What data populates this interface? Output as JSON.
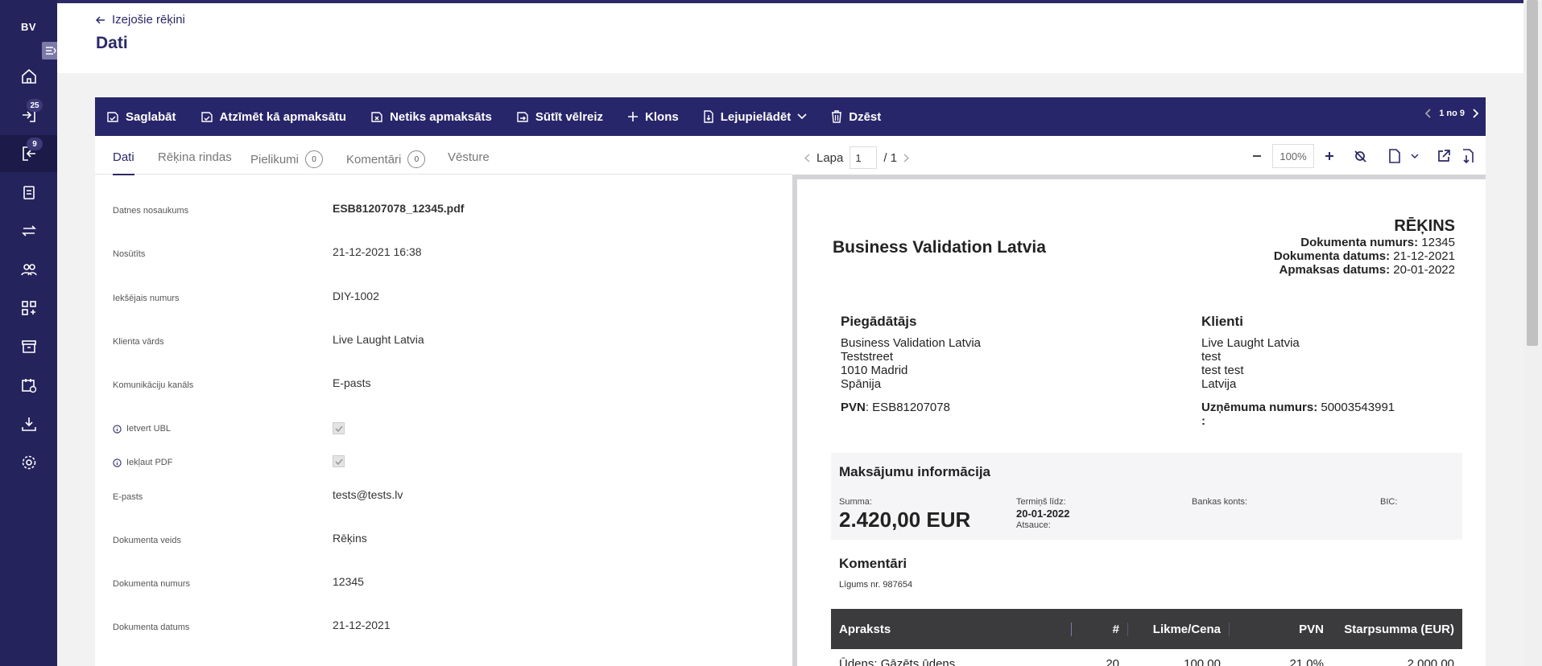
{
  "app": {
    "brand": "BV",
    "nav_badges": {
      "outgoing_in": "25",
      "outgoing_active": "9"
    },
    "icons": [
      "home-icon",
      "inbox-icon",
      "outbox-icon",
      "clipboard-icon",
      "transfer-icon",
      "users-icon",
      "apps-icon",
      "archive-icon",
      "calendar-icon",
      "download-icon",
      "settings-icon"
    ]
  },
  "header": {
    "back_label": "Izejošie rēķini",
    "title": "Dati"
  },
  "toolbar": {
    "save": "Saglabāt",
    "mark_paid": "Atzīmēt kā apmaksātu",
    "not_paid": "Netiks apmaksāts",
    "resend": "Sūtīt vēlreiz",
    "clone": "Klons",
    "download": "Lejupielādēt",
    "delete": "Dzēst",
    "pager": "1 no 9"
  },
  "tabs": [
    {
      "label": "Dati"
    },
    {
      "label": "Rēķina rindas"
    },
    {
      "label": "Pielikumi",
      "count": "0"
    },
    {
      "label": "Komentāri",
      "count": "0"
    },
    {
      "label": "Vēsture"
    }
  ],
  "fields": {
    "file_name": {
      "label": "Datnes nosaukums",
      "value": "ESB81207078_12345.pdf"
    },
    "sent": {
      "label": "Nosūtīts",
      "value": "21-12-2021 16:38"
    },
    "internal_no": {
      "label": "Iekšējais numurs",
      "value": "DIY-1002"
    },
    "client_name": {
      "label": "Klienta vārds",
      "value": "Live Laught Latvia"
    },
    "channel": {
      "label": "Komunikāciju kanāls",
      "value": "E-pasts"
    },
    "include_ubl": {
      "label": "Ietvert UBL",
      "checked": true
    },
    "include_pdf": {
      "label": "Iekļaut PDF",
      "checked": true
    },
    "email": {
      "label": "E-pasts",
      "value": "tests@tests.lv"
    },
    "doc_type": {
      "label": "Dokumenta veids",
      "value": "Rēķins"
    },
    "doc_no": {
      "label": "Dokumenta numurs",
      "value": "12345"
    },
    "doc_date": {
      "label": "Dokumenta datums",
      "value": "21-12-2021"
    }
  },
  "viewer": {
    "page_label": "Lapa",
    "page": "1",
    "page_total": "/ 1",
    "zoom": "100%"
  },
  "invoice": {
    "company": "Business Validation Latvia",
    "heading": "RĒĶINS",
    "doc_no_label": "Dokumenta numurs:",
    "doc_no": "12345",
    "doc_date_label": "Dokumenta datums:",
    "doc_date": "21-12-2021",
    "due_label": "Apmaksas datums:",
    "due": "20-01-2022",
    "supplier": {
      "heading": "Piegādātājs",
      "lines": [
        "Business Validation Latvia",
        "Teststreet",
        "1010 Madrid",
        "Spānija"
      ],
      "vat_label": "PVN",
      "vat": ": ESB81207078"
    },
    "client": {
      "heading": "Klienti",
      "lines": [
        "Live Laught Latvia",
        "test",
        "test test",
        "Latvija"
      ],
      "reg_label": "Uzņēmuma numurs:",
      "reg": "50003543991",
      "reg_tail": ":"
    },
    "payment": {
      "heading": "Maksājumu informācija",
      "sum_label": "Summa:",
      "sum": "2.420,00 EUR",
      "term_label": "Termiņš līdz:",
      "term": "20-01-2022",
      "ref_label": "Atsauce:",
      "bank_label": "Bankas konts:",
      "bic_label": "BIC:"
    },
    "comments_heading": "Komentāri",
    "comment": "Līgums nr. 987654",
    "lines_table": {
      "headers": [
        "Apraksts",
        "#",
        "Likme/Cena",
        "PVN",
        "Starpsumma (EUR)"
      ],
      "rows": [
        [
          "Ūdens: Gāzēts ūdens",
          "20",
          "100,00",
          "21,0%",
          "2.000,00"
        ]
      ]
    }
  },
  "colors": {
    "primary": "#28266a",
    "rail": "#25235c",
    "doc_header": "#3b3b3e"
  }
}
